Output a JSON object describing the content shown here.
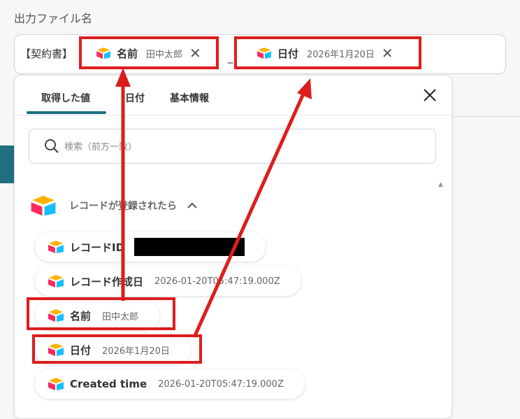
{
  "field": {
    "label": "出力ファイル名",
    "prefix": "【契約書】",
    "separator": "_",
    "chips": [
      {
        "label": "名前",
        "value": "田中太郎",
        "remove": "✕"
      },
      {
        "label": "日付",
        "value": "2026年1月20日",
        "remove": "✕"
      }
    ]
  },
  "panel": {
    "tabs": [
      "取得した値",
      "日付",
      "基本情報"
    ],
    "active_tab": 0,
    "close_label": "✕",
    "search_placeholder": "検索（前方一致）",
    "section_title": "レコードが登録されたら",
    "items": [
      {
        "label": "レコードID",
        "value": "",
        "redacted": true
      },
      {
        "label": "レコード作成日",
        "value": "2026-01-20T05:47:19.000Z"
      },
      {
        "label": "名前",
        "value": "田中太郎"
      },
      {
        "label": "日付",
        "value": "2026年1月20日"
      },
      {
        "label": "Created time",
        "value": "2026-01-20T05:47:19.000Z"
      }
    ]
  },
  "colors": {
    "accent": "#1f6f80",
    "highlight": "#dd1d1d",
    "airtable_yellow": "#fcb400",
    "airtable_red": "#f82b60",
    "airtable_blue": "#18bfff"
  },
  "icons": [
    "airtable-logo-icon",
    "search-icon",
    "close-icon",
    "chevron-up-icon"
  ]
}
